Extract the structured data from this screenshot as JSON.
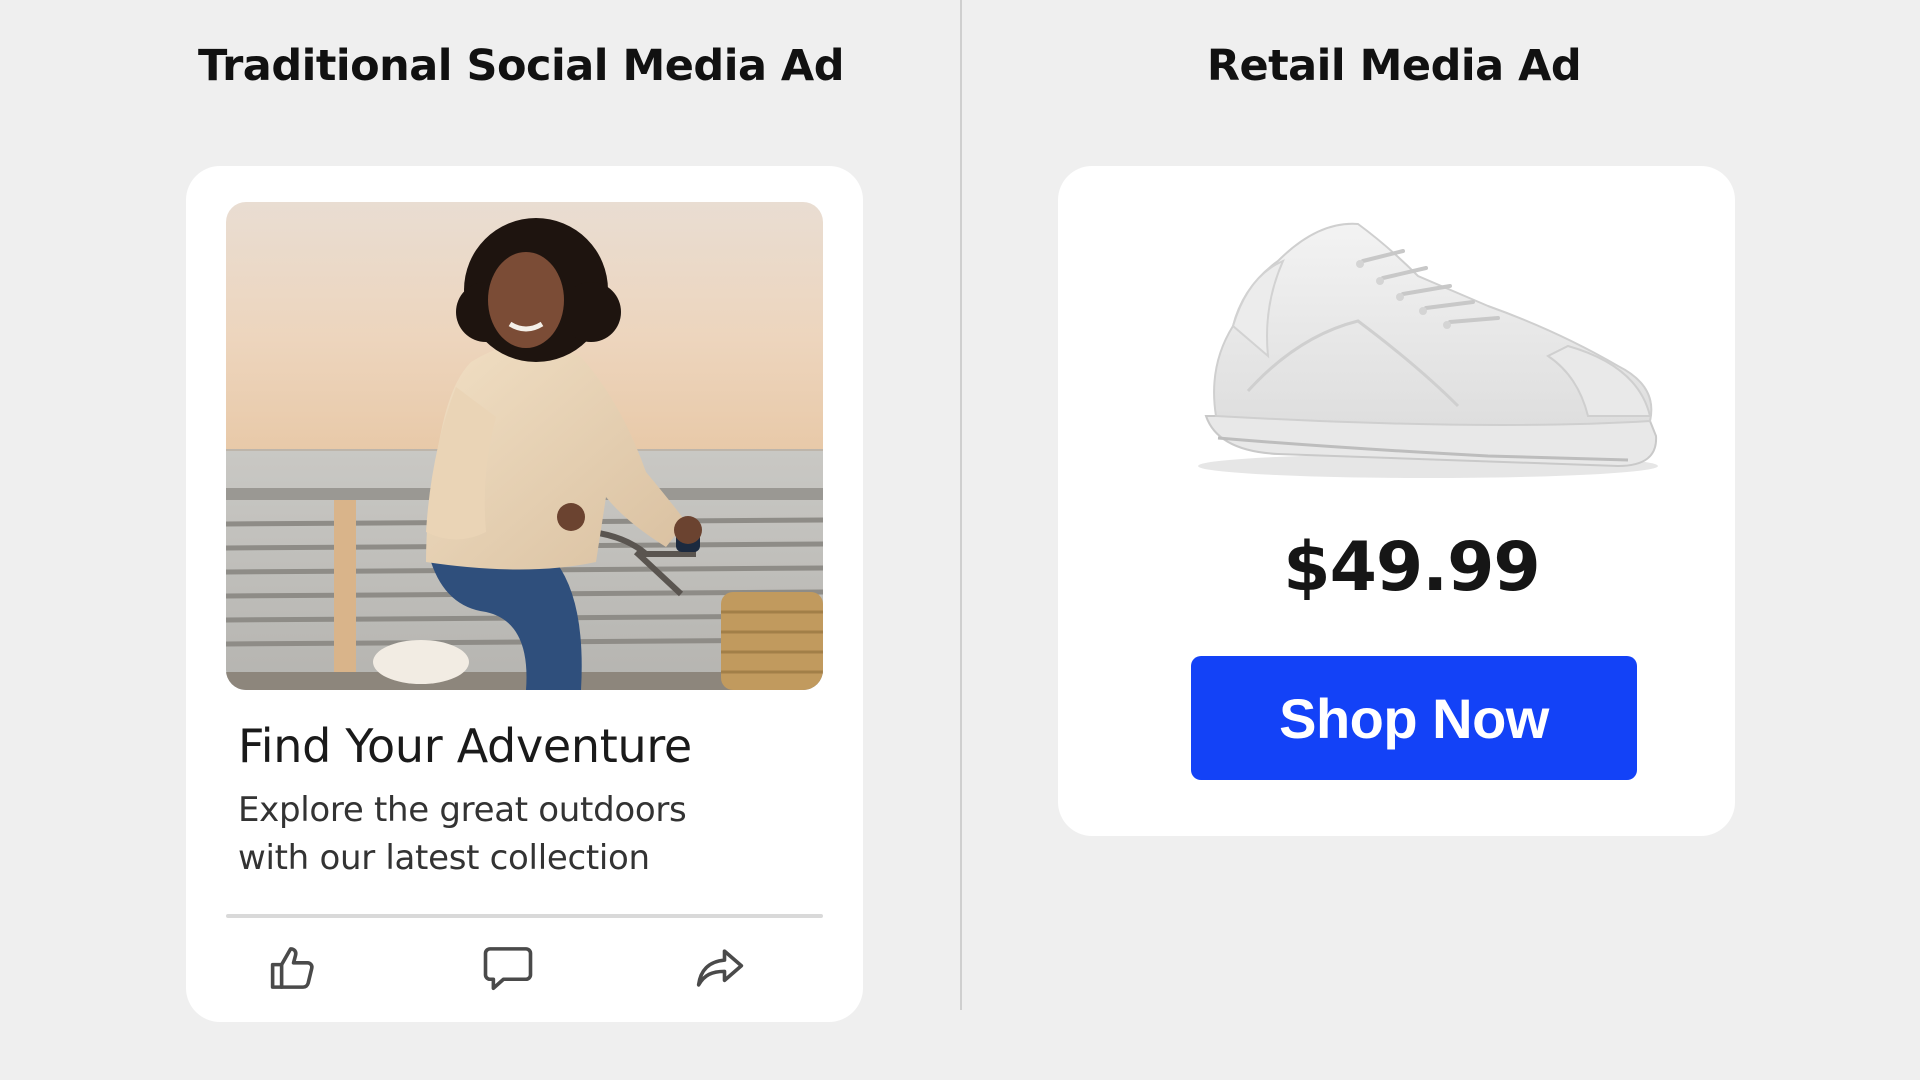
{
  "headings": {
    "left": "Traditional Social Media Ad",
    "right": "Retail Media Ad"
  },
  "social_ad": {
    "image": "woman-riding-bicycle-photo",
    "title": "Find Your Adventure",
    "body_lines": [
      "Explore the great outdoors",
      "with our latest collection"
    ],
    "actions": [
      {
        "icon": "thumbs-up-icon"
      },
      {
        "icon": "comment-icon"
      },
      {
        "icon": "share-icon"
      }
    ]
  },
  "retail_ad": {
    "image": "white-sneaker-photo",
    "price": "$49.99",
    "button_label": "Shop Now"
  },
  "colors": {
    "background": "#efefef",
    "card": "#ffffff",
    "cta_blue": "#1342f7",
    "text": "#111111"
  }
}
